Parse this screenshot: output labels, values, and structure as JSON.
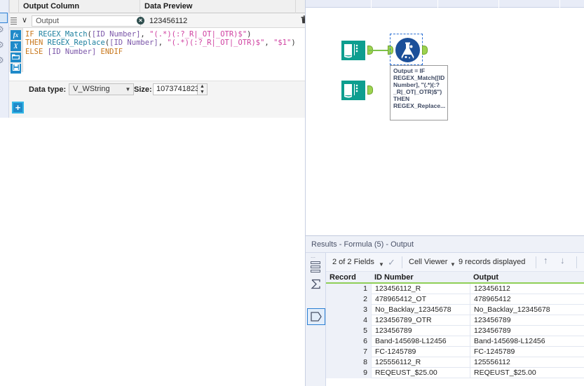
{
  "config_panel": {
    "headers": {
      "output_column": "Output Column",
      "data_preview": "Data Preview"
    },
    "output_name_value": "Output",
    "output_name_placeholder": "Output",
    "clear_badge": "×",
    "data_preview_value": "123456112",
    "trash_icon": "🗑",
    "chevron_icon": "∨",
    "editor_tools": [
      {
        "name": "function-icon",
        "label": "fx"
      },
      {
        "name": "variable-icon",
        "label": "X"
      },
      {
        "name": "open-folder-icon",
        "label": "▰"
      },
      {
        "name": "save-icon",
        "label": "▣"
      }
    ],
    "formula": {
      "line1": {
        "kw": "IF",
        "fn": "REGEX_Match",
        "open": "(",
        "field": "[ID Number]",
        "comma": ", ",
        "str": "\"(.*)(:?_R|_OT|_OTR)$\"",
        "close": ")"
      },
      "line2": {
        "kw": "THEN",
        "fn": "REGEX_Replace",
        "open": "(",
        "field": "[ID Number]",
        "comma": ", ",
        "str": "\"(.*)(:?_R|_OT|_OTR)$\"",
        "comma2": ", ",
        "str2": "\"$1\"",
        "close": ")"
      },
      "line3": {
        "kw": "ELSE",
        "field": "[ID Number]",
        "kw2": "ENDIF"
      },
      "full_text": "IF REGEX_Match([ID Number], \"(.*)(:?_R|_OT|_OTR)$\")\nTHEN REGEX_Replace([ID Number], \"(.*)(:?_R|_OT|_OTR)$\", \"$1\")\nELSE [ID Number] ENDIF"
    },
    "data_type_label": "Data type:",
    "data_type_value": "V_WString",
    "size_label": "Size:",
    "size_value": "1073741823",
    "add_button_label": "+"
  },
  "canvas": {
    "tool_tooltip": "Output = IF REGEX_Match([ID Number], \"(.*)(:?_R|_OT|_OTR)$\") THEN REGEX_Replace...",
    "nodes": [
      {
        "name": "text-input-tool-1",
        "icon": "book-icon"
      },
      {
        "name": "text-input-tool-2",
        "icon": "book-icon"
      },
      {
        "name": "formula-tool",
        "icon": "flask-icon",
        "selected": true
      }
    ]
  },
  "results": {
    "title": "Results - Formula (5) - Output",
    "toolbar": {
      "fields_label": "2 of 2 Fields",
      "checkmark_icon": "✓",
      "viewer_label": "Cell Viewer",
      "records_label": "9 records displayed",
      "up_icon": "↑",
      "down_icon": "↓"
    },
    "columns": [
      "Record",
      "ID Number",
      "Output"
    ],
    "rows": [
      {
        "record": "1",
        "id_number": "123456112_R",
        "output": "123456112"
      },
      {
        "record": "2",
        "id_number": "478965412_OT",
        "output": "478965412"
      },
      {
        "record": "3",
        "id_number": "No_Backlay_12345678",
        "output": "No_Backlay_12345678"
      },
      {
        "record": "4",
        "id_number": "123456789_OTR",
        "output": "123456789"
      },
      {
        "record": "5",
        "id_number": "123456789",
        "output": "123456789"
      },
      {
        "record": "6",
        "id_number": "Band-145698-L12456",
        "output": "Band-145698-L12456"
      },
      {
        "record": "7",
        "id_number": "FC-1245789",
        "output": "FC-1245789"
      },
      {
        "record": "8",
        "id_number": "125556112_R",
        "output": "125556112"
      },
      {
        "record": "9",
        "id_number": "REQEUST_$25.00",
        "output": "REQEUST_$25.00"
      }
    ]
  },
  "colors": {
    "accent_blue": "#1f8ac9",
    "tool_teal": "#0e9e8f",
    "anchor_green": "#9dd34f",
    "header_underline": "#8fcf57",
    "formula_node": "#1b4f99"
  }
}
